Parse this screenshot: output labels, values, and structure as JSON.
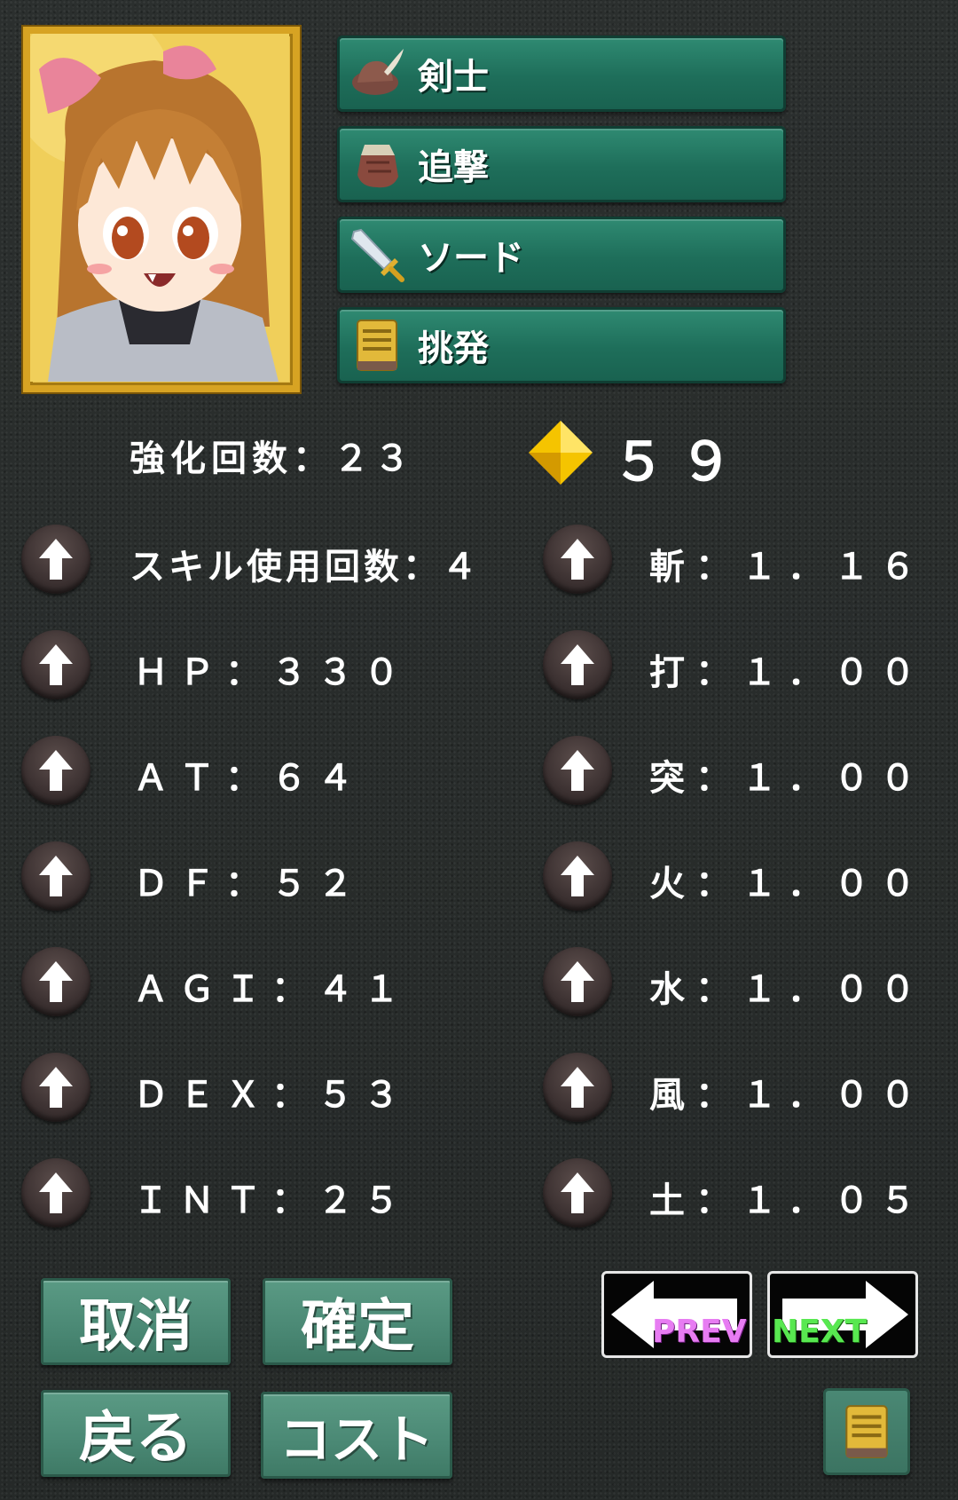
{
  "skills": [
    {
      "label": "剣士",
      "icon": "feather-hat-icon"
    },
    {
      "label": "追撃",
      "icon": "gauntlet-icon"
    },
    {
      "label": "ソード",
      "icon": "sword-icon"
    },
    {
      "label": "挑発",
      "icon": "book-icon"
    }
  ],
  "enhance": {
    "label": "強化回数：２３"
  },
  "points": {
    "value": "５９",
    "icon": "gem-icon"
  },
  "stats_left": [
    "スキル使用回数：４",
    "ＨＰ：３３０",
    "ＡＴ：６４",
    "ＤＦ：５２",
    "ＡＧＩ：４１",
    "ＤＥＸ：５３",
    "ＩＮＴ：２５"
  ],
  "stats_right": [
    "斬：１．１６",
    "打：１．００",
    "突：１．００",
    "火：１．００",
    "水：１．００",
    "風：１．００",
    "土：１．０５"
  ],
  "buttons": {
    "cancel": "取消",
    "confirm": "確定",
    "back": "戻る",
    "cost": "コスト",
    "prev": "PREV",
    "next": "NEXT"
  },
  "colors": {
    "skill_button": "#1e6e5a",
    "action_button": "#4a8874",
    "prev_text": "#e77cf2",
    "next_text": "#58e850",
    "gem": "#f5c400"
  }
}
